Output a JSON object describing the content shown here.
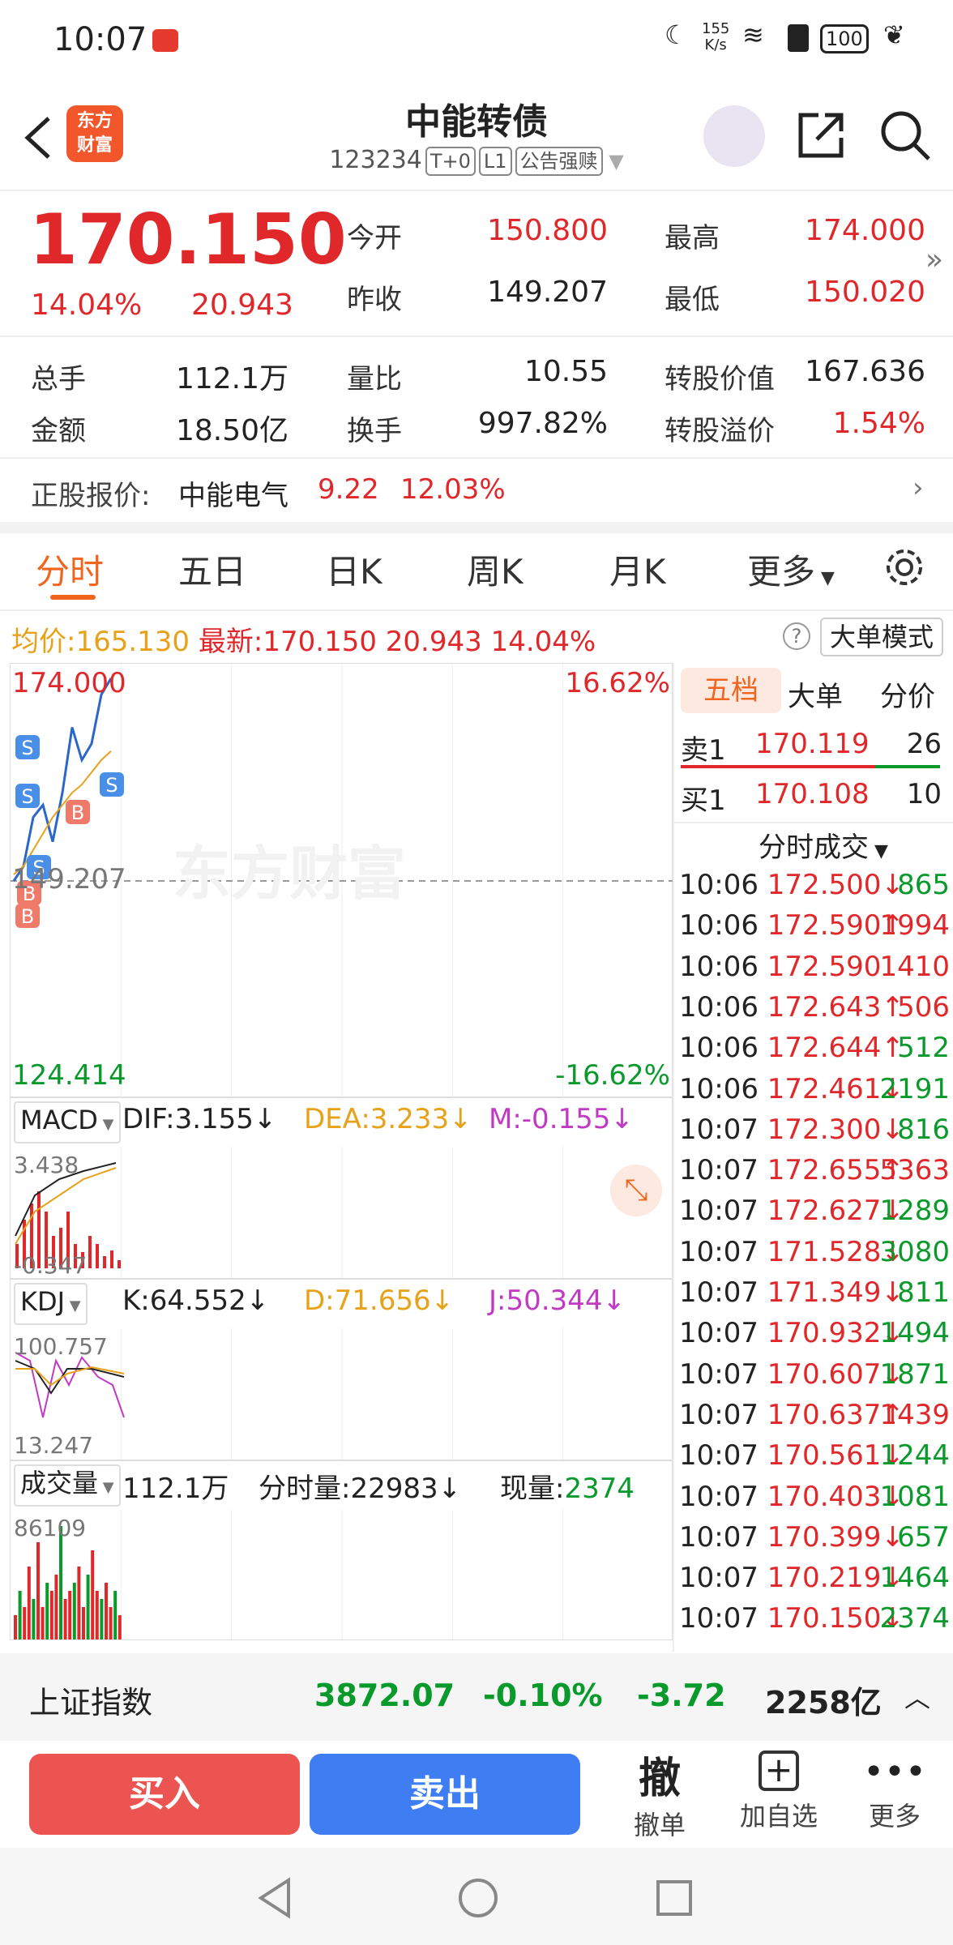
{
  "status_bar": {
    "time": "10:07",
    "net_speed_top": "155",
    "net_speed_bottom": "K/s",
    "battery": "100"
  },
  "header": {
    "title": "中能转债",
    "code": "123234",
    "tags": [
      "T+0",
      "L1",
      "公告强赎"
    ],
    "logo_line1": "东方",
    "logo_line2": "财富"
  },
  "quote": {
    "price": "170.150",
    "change_pct": "14.04%",
    "change": "20.943",
    "open_label": "今开",
    "open": "150.800",
    "prev_label": "昨收",
    "prev": "149.207",
    "high_label": "最高",
    "high": "174.000",
    "low_label": "最低",
    "low": "150.020",
    "vol_label": "总手",
    "vol": "112.1万",
    "amt_label": "金额",
    "amt": "18.50亿",
    "ratio_label": "量比",
    "ratio": "10.55",
    "turn_label": "换手",
    "turn": "997.82%",
    "conv_label": "转股价值",
    "conv": "167.636",
    "prem_label": "转股溢价",
    "prem": "1.54%"
  },
  "stock": {
    "label": "正股报价:",
    "name": "中能电气",
    "price": "9.22",
    "pct": "12.03%"
  },
  "tabs": [
    "分时",
    "五日",
    "日K",
    "周K",
    "月K",
    "更多"
  ],
  "chart_header": {
    "avg_label": "均价:",
    "avg": "165.130",
    "last_label": "最新:",
    "last": "170.150",
    "chg": "20.943",
    "pct": "14.04%",
    "mode": "大单模式"
  },
  "chart_data": {
    "type": "line",
    "ymax": "174.000",
    "ymax_pct": "16.62%",
    "ymid": "149.207",
    "ymin": "124.414",
    "ymin_pct": "-16.62%",
    "watermark": "东方财富",
    "price": [
      149.2,
      151,
      157,
      158.5,
      154,
      160,
      168,
      164,
      166,
      172,
      174
    ],
    "avg": [
      150,
      151,
      153,
      155,
      157,
      158.5,
      160,
      161,
      162.5,
      164,
      165.1
    ],
    "bs_markers": [
      "S",
      "S",
      "S",
      "S",
      "B",
      "B",
      "B"
    ]
  },
  "macd": {
    "name": "MACD",
    "dif": "DIF:3.155↓",
    "dea": "DEA:3.233↓",
    "m": "M:-0.155↓",
    "top": "3.438",
    "bottom": "-0.347"
  },
  "kdj": {
    "name": "KDJ",
    "k": "K:64.552↓",
    "d": "D:71.656↓",
    "j": "J:50.344↓",
    "top": "100.757",
    "bottom": "13.247"
  },
  "volume": {
    "name": "成交量",
    "total": "112.1万",
    "fs_label": "分时量:22983↓",
    "now_label": "现量:",
    "now": "2374",
    "top": "86109"
  },
  "right_panel": {
    "tabs": [
      "五档",
      "大单",
      "分价"
    ],
    "sell_label": "卖1",
    "sell_price": "170.119",
    "sell_vol": "26",
    "buy_label": "买1",
    "buy_price": "170.108",
    "buy_vol": "10",
    "trades_title": "分时成交",
    "trades": [
      {
        "t": "10:06",
        "p": "172.500",
        "d": "↓",
        "v": "865",
        "c": "red",
        "vc": "green"
      },
      {
        "t": "10:06",
        "p": "172.590",
        "d": "↑",
        "v": "1994",
        "c": "red",
        "vc": "red"
      },
      {
        "t": "10:06",
        "p": "172.590",
        "d": "",
        "v": "1410",
        "c": "red",
        "vc": "red"
      },
      {
        "t": "10:06",
        "p": "172.643",
        "d": "↑",
        "v": "506",
        "c": "red",
        "vc": "red"
      },
      {
        "t": "10:06",
        "p": "172.644",
        "d": "↑",
        "v": "512",
        "c": "red",
        "vc": "green"
      },
      {
        "t": "10:06",
        "p": "172.461",
        "d": "↓",
        "v": "2191",
        "c": "red",
        "vc": "green"
      },
      {
        "t": "10:07",
        "p": "172.300",
        "d": "↓",
        "v": "816",
        "c": "red",
        "vc": "green"
      },
      {
        "t": "10:07",
        "p": "172.655",
        "d": "↑",
        "v": "5363",
        "c": "red",
        "vc": "red"
      },
      {
        "t": "10:07",
        "p": "172.627",
        "d": "↓",
        "v": "1289",
        "c": "red",
        "vc": "green"
      },
      {
        "t": "10:07",
        "p": "171.528",
        "d": "↓",
        "v": "3080",
        "c": "red",
        "vc": "green"
      },
      {
        "t": "10:07",
        "p": "171.349",
        "d": "↓",
        "v": "811",
        "c": "red",
        "vc": "green"
      },
      {
        "t": "10:07",
        "p": "170.932",
        "d": "↓",
        "v": "1494",
        "c": "red",
        "vc": "green"
      },
      {
        "t": "10:07",
        "p": "170.607",
        "d": "↓",
        "v": "1871",
        "c": "red",
        "vc": "green"
      },
      {
        "t": "10:07",
        "p": "170.637",
        "d": "↑",
        "v": "1439",
        "c": "red",
        "vc": "red"
      },
      {
        "t": "10:07",
        "p": "170.561",
        "d": "↓",
        "v": "1244",
        "c": "red",
        "vc": "green"
      },
      {
        "t": "10:07",
        "p": "170.403",
        "d": "↓",
        "v": "1081",
        "c": "red",
        "vc": "green"
      },
      {
        "t": "10:07",
        "p": "170.399",
        "d": "↓",
        "v": "657",
        "c": "red",
        "vc": "green"
      },
      {
        "t": "10:07",
        "p": "170.219",
        "d": "↓",
        "v": "1464",
        "c": "red",
        "vc": "green"
      },
      {
        "t": "10:07",
        "p": "170.150",
        "d": "↓",
        "v": "2374",
        "c": "red",
        "vc": "green"
      }
    ]
  },
  "index_bar": {
    "name": "上证指数",
    "value": "3872.07",
    "pct": "-0.10%",
    "chg": "-3.72",
    "amount": "2258亿"
  },
  "actions": {
    "buy": "买入",
    "sell": "卖出",
    "cancel_icon": "撤",
    "cancel": "撤单",
    "watch": "加自选",
    "more": "更多"
  }
}
